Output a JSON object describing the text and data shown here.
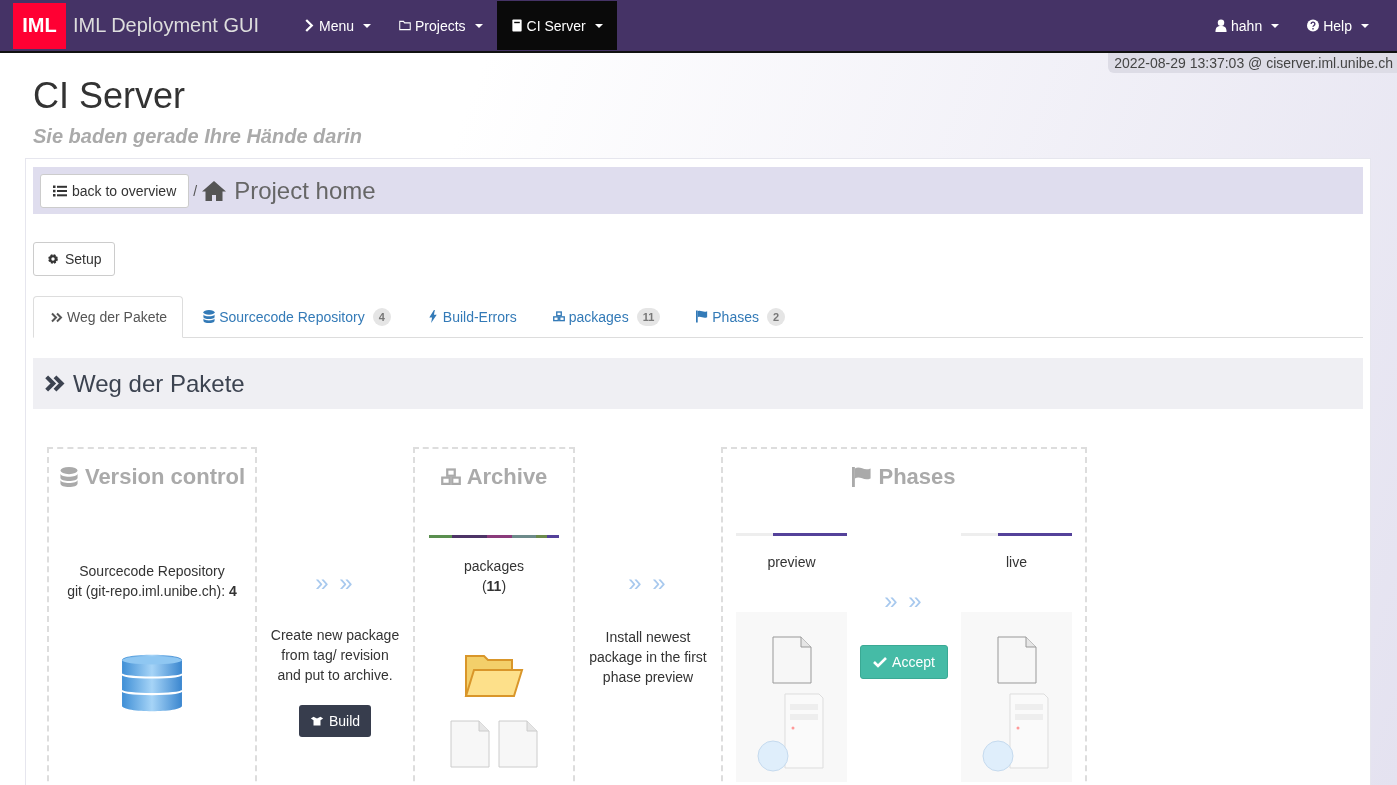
{
  "navbar": {
    "logo": "IML",
    "brand": "IML Deployment GUI",
    "menus": [
      {
        "label": "Menu",
        "selected": false
      },
      {
        "label": "Projects",
        "selected": false
      },
      {
        "label": "CI Server",
        "selected": true
      }
    ],
    "right_menus": [
      {
        "label": "hahn"
      },
      {
        "label": "Help"
      }
    ]
  },
  "status": "2022-08-29 13:37:03 @ ciserver.iml.unibe.ch",
  "page": {
    "title": "CI Server",
    "subtitle": "Sie baden gerade Ihre Hände darin"
  },
  "breadcrumb": {
    "back_button": "back to overview",
    "separator": "/",
    "title": "Project home"
  },
  "setup_button": "Setup",
  "tabs": [
    {
      "label": "Weg der Pakete",
      "selected": true
    },
    {
      "label": "Sourcecode Repository",
      "badge": "4",
      "selected": false
    },
    {
      "label": "Build-Errors",
      "selected": false
    },
    {
      "label": "packages",
      "badge": "11",
      "selected": false
    },
    {
      "label": "Phases",
      "badge": "2",
      "selected": false
    }
  ],
  "section_title": "Weg der Pakete",
  "flow": {
    "version_control": {
      "title": "Version control",
      "lines": [
        "Sourcecode Repository",
        "git (git-repo.iml.unibe.ch): **4**"
      ]
    },
    "build_step": {
      "arrows": "» »",
      "text": "Create new package from tag/ revision and put to archive.",
      "button": "Build"
    },
    "archive": {
      "title": "Archive",
      "lines": [
        "packages",
        "(**11**)"
      ]
    },
    "install_step": {
      "arrows": "» »",
      "text": "Install newest package in the first phase preview"
    },
    "phases": {
      "title": "Phases",
      "items": [
        {
          "name": "preview"
        },
        {
          "name": "live"
        }
      ],
      "arrows": "» »",
      "button": "Accept"
    }
  }
}
